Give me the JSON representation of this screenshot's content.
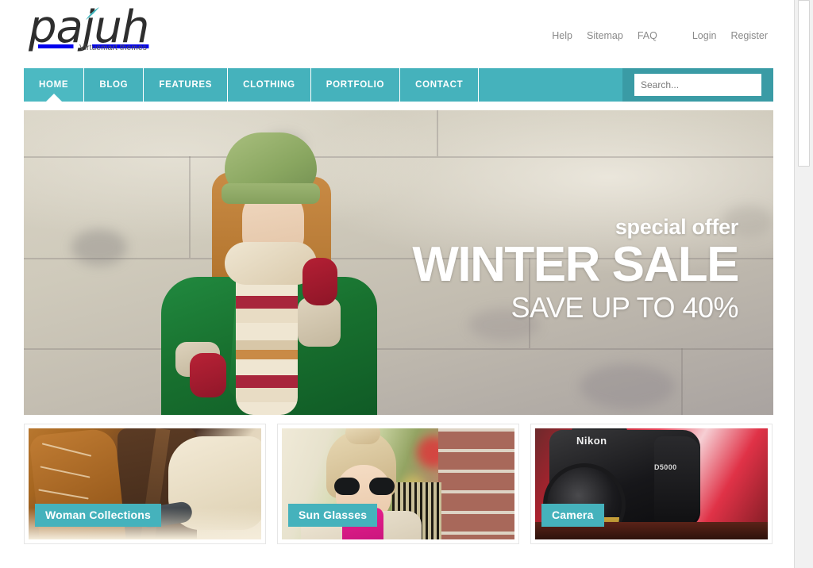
{
  "brand": {
    "name": "pajuh",
    "tagline": "Virtuemart themes",
    "accent_color": "#45b2bc"
  },
  "header": {
    "top_links": [
      {
        "label": "Help"
      },
      {
        "label": "Sitemap"
      },
      {
        "label": "FAQ"
      },
      {
        "label": "Login"
      },
      {
        "label": "Register"
      }
    ]
  },
  "nav": {
    "items": [
      {
        "label": "HOME",
        "active": true
      },
      {
        "label": "BLOG",
        "active": false
      },
      {
        "label": "FEATURES",
        "active": false
      },
      {
        "label": "CLOTHING",
        "active": false
      },
      {
        "label": "PORTFOLIO",
        "active": false
      },
      {
        "label": "CONTACT",
        "active": false
      }
    ]
  },
  "search": {
    "placeholder": "Search...",
    "value": ""
  },
  "hero": {
    "kicker": "special offer",
    "title": "WINTER SALE",
    "subtitle": "SAVE UP TO 40%"
  },
  "cards": [
    {
      "caption": "Woman Collections"
    },
    {
      "caption": "Sun Glasses"
    },
    {
      "caption": "Camera"
    }
  ],
  "camera_labels": {
    "brand": "Nikon",
    "model": "D5000"
  }
}
